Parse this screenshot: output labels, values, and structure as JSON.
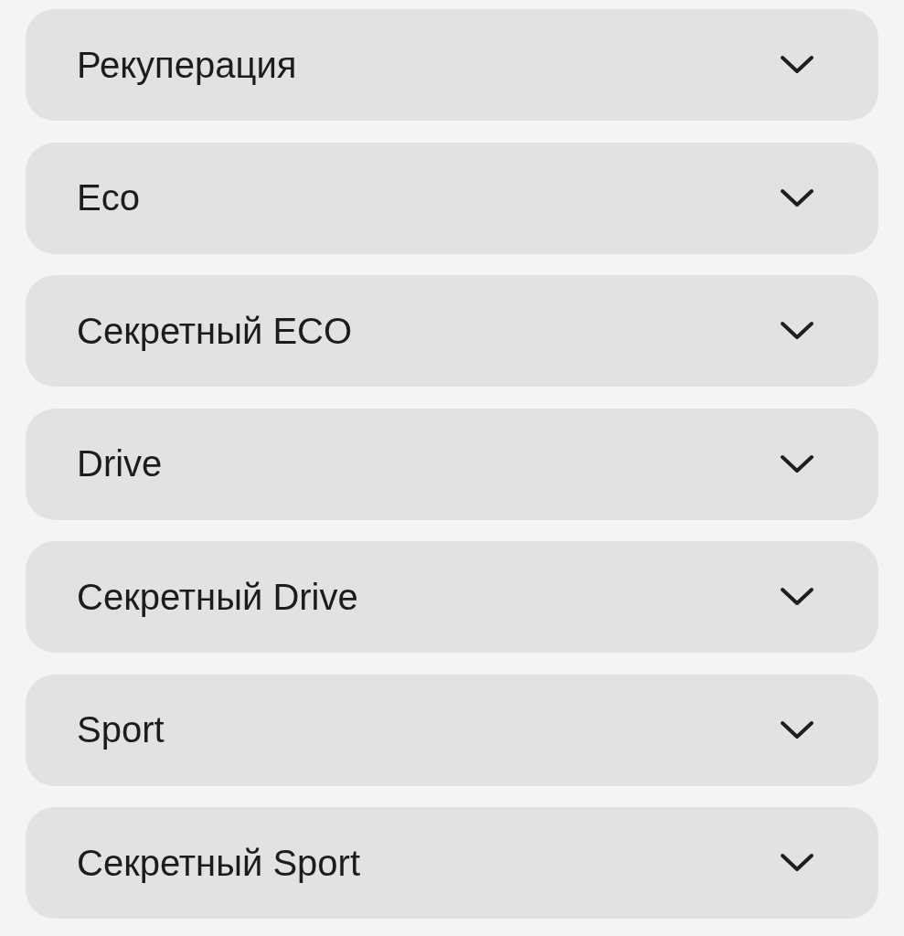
{
  "sections": [
    {
      "title": "Рекуперация",
      "expanded": false
    },
    {
      "title": "Eco",
      "expanded": false
    },
    {
      "title": "Секретный ECO",
      "expanded": false
    },
    {
      "title": "Drive",
      "expanded": false
    },
    {
      "title": "Секретный Drive",
      "expanded": false
    },
    {
      "title": "Sport",
      "expanded": false
    },
    {
      "title": "Секретный Sport",
      "expanded": false
    }
  ]
}
